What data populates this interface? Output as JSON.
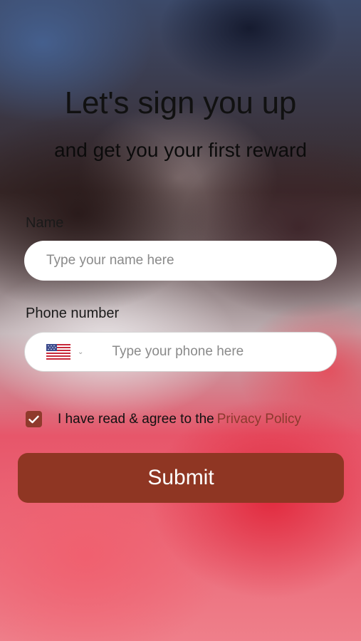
{
  "header": {
    "title": "Let's sign you up",
    "subtitle": "and get you your first reward"
  },
  "form": {
    "name": {
      "label": "Name",
      "placeholder": "Type your name here",
      "value": ""
    },
    "phone": {
      "label": "Phone number",
      "placeholder": "Type your phone here",
      "value": "",
      "country_flag": "us-flag-icon"
    },
    "consent": {
      "checked": true,
      "text": "I have read & agree to the",
      "link": "Privacy Policy"
    },
    "submit_label": "Submit"
  },
  "colors": {
    "accent": "#8f3623",
    "link": "#8b3a2e"
  }
}
